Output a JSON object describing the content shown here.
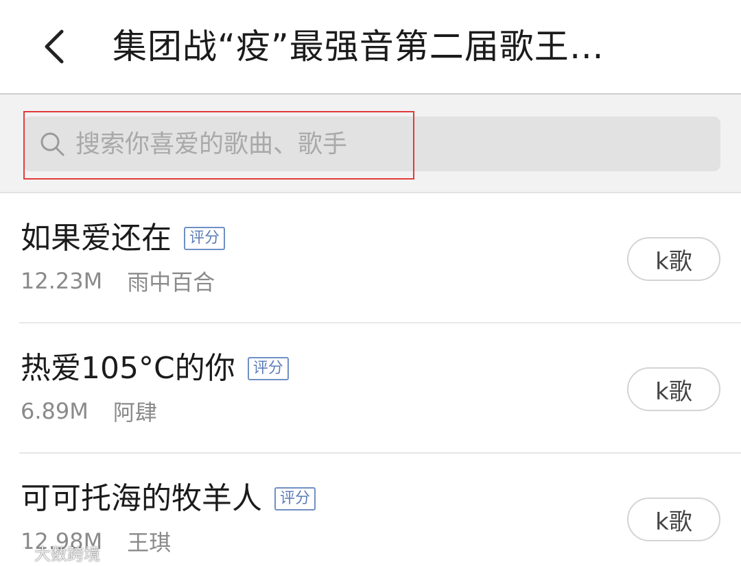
{
  "header": {
    "title": "集团战“疫”最强音第二届歌王…",
    "back_icon": "chevron-left-icon"
  },
  "search": {
    "placeholder": "搜索你喜爱的歌曲、歌手",
    "value": "",
    "icon": "search-icon",
    "highlight_color": "#e23a3a"
  },
  "songs": [
    {
      "title": "如果爱还在",
      "badge": "评分",
      "size": "12.23M",
      "artist": "雨中百合",
      "action": "k歌"
    },
    {
      "title": "热爱105°C的你",
      "badge": "评分",
      "size": "6.89M",
      "artist": "阿肆",
      "action": "k歌"
    },
    {
      "title": "可可托海的牧羊人",
      "badge": "评分",
      "size": "12.98M",
      "artist": "王琪",
      "action": "k歌"
    }
  ],
  "watermark": {
    "text": "大数跨境"
  },
  "colors": {
    "badge": "#5d7db8",
    "divider": "#e6e6e6",
    "search_bg": "#e2e2e2"
  }
}
